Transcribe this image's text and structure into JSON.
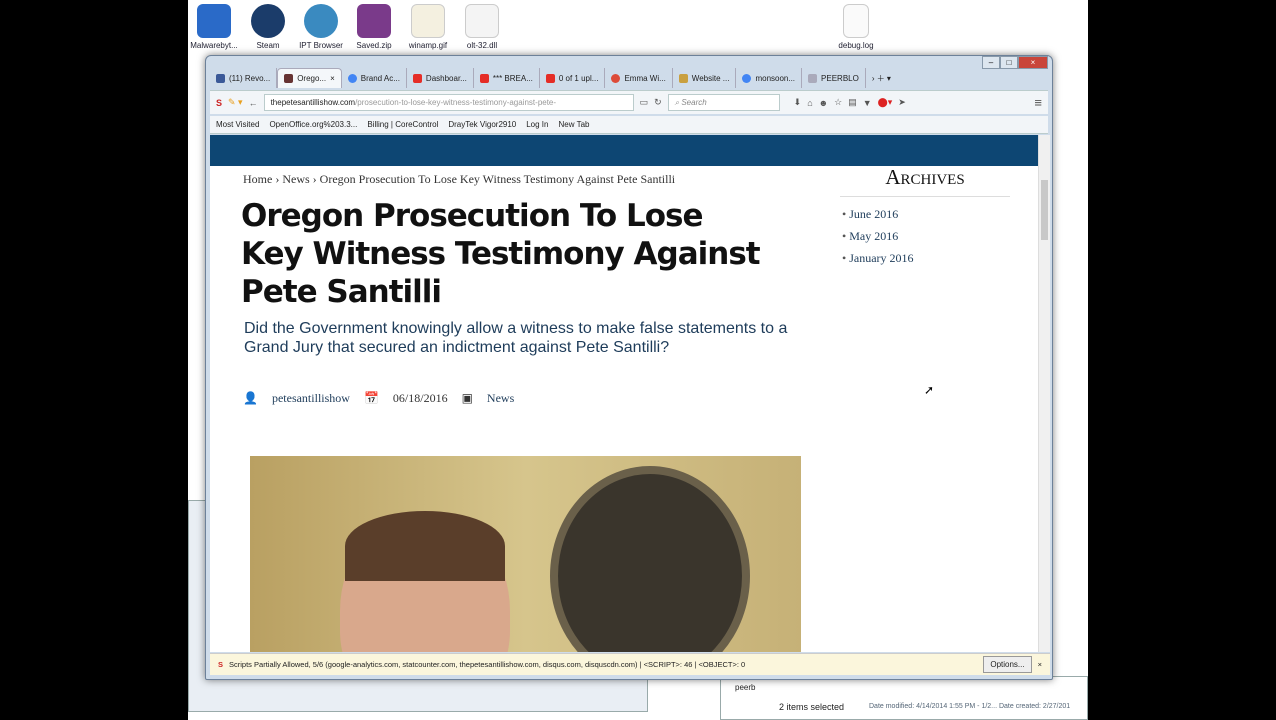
{
  "desktop": {
    "icons": [
      "Malwarebyt...",
      "Steam",
      "IPT Browser",
      "Saved.zip",
      "winamp.gif",
      "olt-32.dll",
      "debug.log"
    ]
  },
  "browser": {
    "tabs": [
      "(11) Revo...",
      "Orego...",
      "Brand Ac...",
      "Dashboar...",
      "*** BREA...",
      "0 of 1 upl...",
      "Emma Wi...",
      "Website ...",
      "monsoon...",
      "PEERBLO"
    ],
    "url_domain": "thepetesantillishow.com",
    "url_path": "/prosecution-to-lose-key-witness-testimony-against-pete-",
    "search_placeholder": "Search",
    "bookmarks": [
      "Most Visited",
      "OpenOffice.org%203.3...",
      "Billing | CoreControl",
      "DrayTek Vigor2910",
      "Log In",
      "New Tab"
    ]
  },
  "article": {
    "breadcrumb": {
      "home": "Home",
      "sep": "›",
      "section": "News",
      "current": "Oregon Prosecution To Lose Key Witness Testimony Against Pete Santilli"
    },
    "title": "Oregon Prosecution To Lose Key Witness Testimony Against Pete Santilli",
    "subtitle": "Did the Government knowingly allow a witness to make false statements to a Grand Jury that secured an indictment against Pete Santilli?",
    "author": "petesantillishow",
    "date": "06/18/2016",
    "category": "News"
  },
  "sidebar": {
    "title": "Archives",
    "items": [
      "June 2016",
      "May 2016",
      "January 2016"
    ]
  },
  "statusbar": {
    "text": "Scripts Partially Allowed, 5/6 (google-analytics.com, statcounter.com, thepetesantillishow.com, disqus.com, disquscdn.com) | <SCRIPT>: 46 | <OBJECT>: 0",
    "options": "Options...",
    "close": "×"
  },
  "explorer": {
    "folder": "peerb",
    "selected": "2 items selected",
    "details": "Date modified: 4/14/2014 1:55 PM - 1/2...  Date created: 2/27/201"
  }
}
